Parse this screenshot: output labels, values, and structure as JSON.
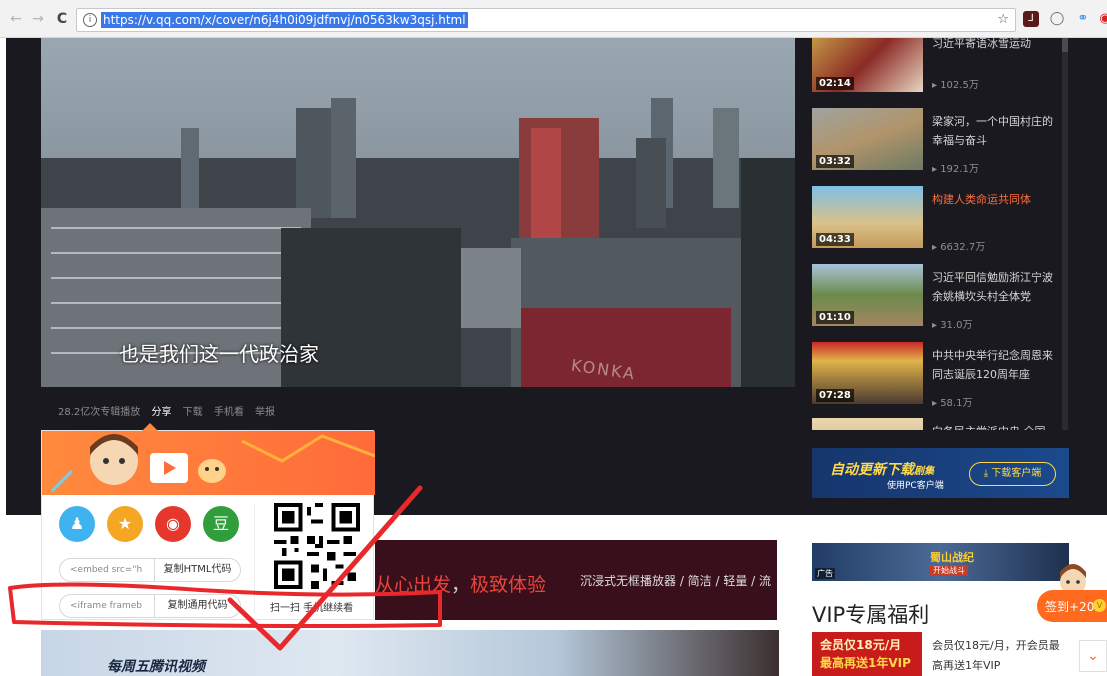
{
  "browser": {
    "url": "https://v.qq.com/x/cover/n6j4h0i09jdfmvj/n0563kw3qsj.html",
    "info_glyph": "i",
    "star_glyph": "☆",
    "back_glyph": "←",
    "forward_glyph": "→",
    "reload_glyph": "C"
  },
  "video": {
    "subtitle": "也是我们这一代政治家",
    "watermark": "KONKA"
  },
  "player_bar": {
    "plays": "28.2亿次专辑播放",
    "share": "分享",
    "download": "下载",
    "phone": "手机看",
    "report": "举报"
  },
  "playlist": [
    {
      "title": "习近平寄语冰雪运动",
      "duration": "02:14",
      "views": "▸ 102.5万",
      "highlight": false
    },
    {
      "title": "梁家河，一个中国村庄的幸福与奋斗",
      "duration": "03:32",
      "views": "▸ 192.1万",
      "highlight": false
    },
    {
      "title": "构建人类命运共同体",
      "duration": "04:33",
      "views": "▸ 6632.7万",
      "highlight": true
    },
    {
      "title": "习近平回信勉励浙江宁波余姚横坎头村全体党",
      "duration": "01:10",
      "views": "▸ 31.0万",
      "highlight": false
    },
    {
      "title": "中共中央举行纪念周恩来同志诞辰120周年座",
      "duration": "07:28",
      "views": "▸ 58.1万",
      "highlight": false
    },
    {
      "title": "向各民主党派中央 全国",
      "duration": "",
      "views": "",
      "highlight": false
    }
  ],
  "ad": {
    "title": "自动更新下载",
    "title_suffix": "剧集",
    "subtitle": "使用PC客户端",
    "button": "⤓ 下载客户端"
  },
  "share_panel": {
    "icons": [
      {
        "name": "qq-icon",
        "glyph": "♟",
        "color": "#3fb2f0"
      },
      {
        "name": "qzone-icon",
        "glyph": "★",
        "color": "#f5a623"
      },
      {
        "name": "weibo-icon",
        "glyph": "◉",
        "color": "#e6372c"
      },
      {
        "name": "douban-icon",
        "glyph": "豆",
        "color": "#2f9e3b"
      }
    ],
    "embed_value": "<embed src=\"h",
    "embed_btn": "复制HTML代码",
    "iframe_value": "<iframe frameb",
    "iframe_btn": "复制通用代码",
    "qr_caption": "扫一扫 手机继续看"
  },
  "banner": {
    "slogan_a": "从心出发",
    "slogan_b": "极致体验",
    "features": "沉浸式无框播放器 / 简洁 / 轻量 / 流",
    "bottom_text": "每周五腾讯视频"
  },
  "sidebar": {
    "game_logo": "蜀山战纪",
    "game_tag": "开始战斗",
    "ad_label": "广告",
    "vip_title": "VIP专属福利",
    "vip_thumb_a": "会员仅18元/月",
    "vip_thumb_b": "最高再送1年VIP",
    "vip_desc": "会员仅18元/月，开会员最高再送1年VIP",
    "signin": "签到+20",
    "coin": "V",
    "back_top": "⌄"
  },
  "colors": {
    "accent": "#ff6a1f",
    "highlight": "#ff6d3b",
    "dark": "#19191f",
    "url_select": "#3b78e7",
    "annotation": "#e8282a"
  }
}
